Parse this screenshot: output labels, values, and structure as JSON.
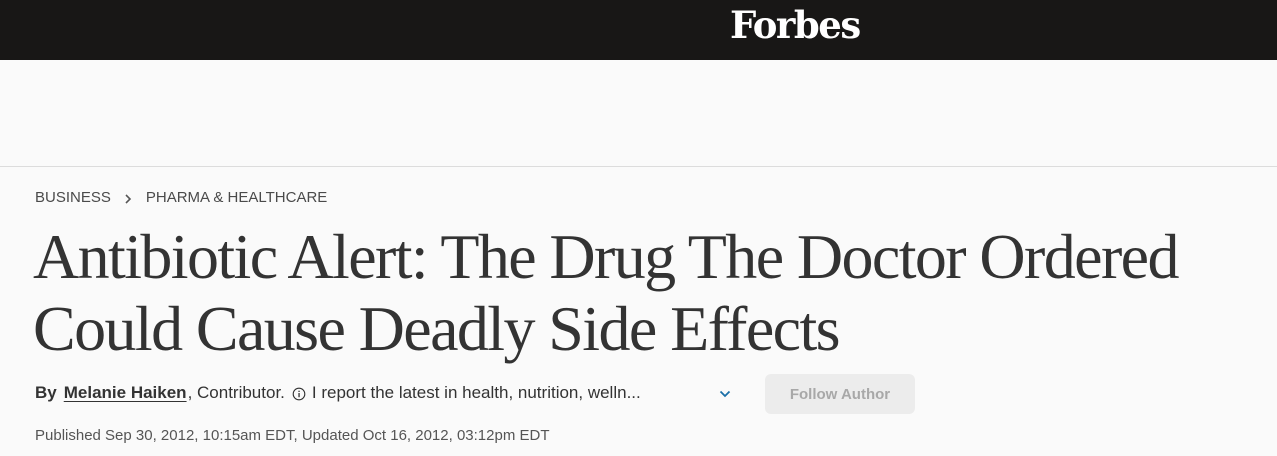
{
  "header": {
    "logo_text": "Forbes",
    "background_color": "#181716"
  },
  "breadcrumb": {
    "items": [
      "BUSINESS",
      "PHARMA & HEALTHCARE"
    ],
    "separator_icon": "chevron-right-icon"
  },
  "article": {
    "title": "Antibiotic Alert: The Drug The Doctor Ordered Could Cause Deadly Side Effects",
    "byline": {
      "by_label": "By",
      "author": "Melanie Haiken",
      "role": ", Contributor.",
      "info_icon": "info-icon",
      "bio": "I report the latest in health, nutrition, welln...",
      "expand_icon": "chevron-down-icon",
      "expand_icon_color": "#1a6fa8"
    },
    "follow_button_label": "Follow Author",
    "published": "Published Sep 30, 2012, 10:15am EDT, Updated Oct 16, 2012, 03:12pm EDT"
  }
}
